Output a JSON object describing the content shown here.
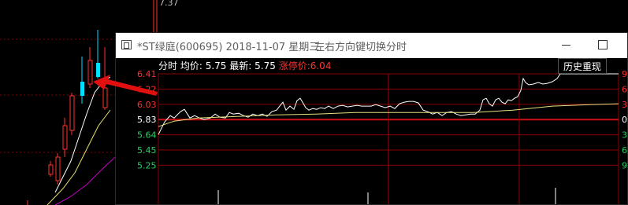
{
  "background_chart": {
    "top_price_label": "7.37"
  },
  "window": {
    "title": "*ST绿庭(600695)  2018-11-07 星期三",
    "hint": "左右方向键切换分时"
  },
  "infobar": {
    "mode": "分时",
    "avg_label": "均价:",
    "avg_value": "5.75",
    "latest_label": "最新:",
    "latest_value": "5.75",
    "limit_up_label": "涨停价:",
    "limit_up_value": "6.04"
  },
  "history_button": "历史重现",
  "chart_data": {
    "type": "line",
    "y_axis_left": [
      "6.41",
      "6.22",
      "6.03",
      "5.83",
      "5.64",
      "5.45",
      "5.25"
    ],
    "y_axis_right": [
      "9.",
      "6.",
      "3.",
      "0.",
      "3.",
      "6.",
      "9."
    ],
    "ylim": [
      5.25,
      6.41
    ],
    "reference_price": 5.83,
    "limit_up_price": 6.04,
    "series": [
      {
        "role": "price",
        "color": "#ffffff",
        "points": [
          [
            0,
            5.64
          ],
          [
            3,
            5.7
          ],
          [
            8,
            5.8
          ],
          [
            15,
            5.88
          ],
          [
            20,
            5.85
          ],
          [
            28,
            5.93
          ],
          [
            33,
            5.96
          ],
          [
            40,
            5.85
          ],
          [
            46,
            5.88
          ],
          [
            52,
            5.85
          ],
          [
            58,
            5.83
          ],
          [
            66,
            5.85
          ],
          [
            72,
            5.9
          ],
          [
            78,
            5.86
          ],
          [
            85,
            5.85
          ],
          [
            90,
            5.92
          ],
          [
            95,
            5.9
          ],
          [
            102,
            5.91
          ],
          [
            108,
            5.88
          ],
          [
            114,
            5.86
          ],
          [
            120,
            5.9
          ],
          [
            126,
            5.88
          ],
          [
            132,
            5.9
          ],
          [
            138,
            5.87
          ],
          [
            144,
            5.93
          ],
          [
            150,
            5.95
          ],
          [
            154,
            6.0
          ],
          [
            158,
            6.05
          ],
          [
            162,
            5.95
          ],
          [
            167,
            6.0
          ],
          [
            172,
            5.96
          ],
          [
            176,
            6.07
          ],
          [
            180,
            6.1
          ],
          [
            183,
            6.05
          ],
          [
            187,
            5.98
          ],
          [
            191,
            5.95
          ],
          [
            196,
            5.97
          ],
          [
            201,
            5.96
          ],
          [
            206,
            5.98
          ],
          [
            211,
            5.97
          ],
          [
            216,
            6.0
          ],
          [
            222,
            5.97
          ],
          [
            228,
            6.0
          ],
          [
            234,
            6.01
          ],
          [
            240,
            5.99
          ],
          [
            246,
            6.0
          ],
          [
            252,
            6.01
          ],
          [
            258,
            6.0
          ],
          [
            264,
            6.0
          ],
          [
            270,
            6.0
          ],
          [
            276,
            6.02
          ],
          [
            282,
            6.0
          ],
          [
            288,
            5.98
          ],
          [
            294,
            6.0
          ],
          [
            300,
            5.97
          ],
          [
            306,
            6.03
          ],
          [
            312,
            6.05
          ],
          [
            318,
            6.06
          ],
          [
            324,
            6.06
          ],
          [
            330,
            6.04
          ],
          [
            336,
            5.95
          ],
          [
            342,
            5.93
          ],
          [
            348,
            5.9
          ],
          [
            354,
            5.92
          ],
          [
            360,
            5.88
          ],
          [
            366,
            5.92
          ],
          [
            372,
            5.93
          ],
          [
            378,
            5.9
          ],
          [
            384,
            5.88
          ],
          [
            390,
            5.89
          ],
          [
            396,
            5.9
          ],
          [
            402,
            5.9
          ],
          [
            408,
            5.95
          ],
          [
            412,
            6.08
          ],
          [
            416,
            6.1
          ],
          [
            420,
            6.03
          ],
          [
            424,
            6.0
          ],
          [
            428,
            6.08
          ],
          [
            432,
            6.1
          ],
          [
            436,
            6.05
          ],
          [
            440,
            6.03
          ],
          [
            444,
            6.08
          ],
          [
            448,
            6.07
          ],
          [
            452,
            6.1
          ],
          [
            456,
            6.12
          ],
          [
            460,
            6.2
          ],
          [
            463,
            6.35
          ],
          [
            466,
            6.3
          ],
          [
            470,
            6.27
          ],
          [
            476,
            6.28
          ],
          [
            482,
            6.3
          ],
          [
            488,
            6.28
          ],
          [
            494,
            6.29
          ],
          [
            500,
            6.31
          ],
          [
            506,
            6.35
          ],
          [
            510,
            6.41
          ],
          [
            520,
            6.41
          ],
          [
            584,
            6.41
          ]
        ]
      },
      {
        "role": "average",
        "color": "#e8e080",
        "points": [
          [
            0,
            5.74
          ],
          [
            20,
            5.81
          ],
          [
            50,
            5.85
          ],
          [
            100,
            5.87
          ],
          [
            150,
            5.89
          ],
          [
            200,
            5.9
          ],
          [
            250,
            5.92
          ],
          [
            300,
            5.92
          ],
          [
            350,
            5.92
          ],
          [
            400,
            5.92
          ],
          [
            450,
            5.95
          ],
          [
            500,
            6.0
          ],
          [
            550,
            6.02
          ],
          [
            584,
            6.03
          ]
        ]
      }
    ]
  },
  "colors": {
    "grid": "#8a0000",
    "price_up": "#ff3030",
    "price_down": "#28d060",
    "arrow": "#e01010"
  }
}
